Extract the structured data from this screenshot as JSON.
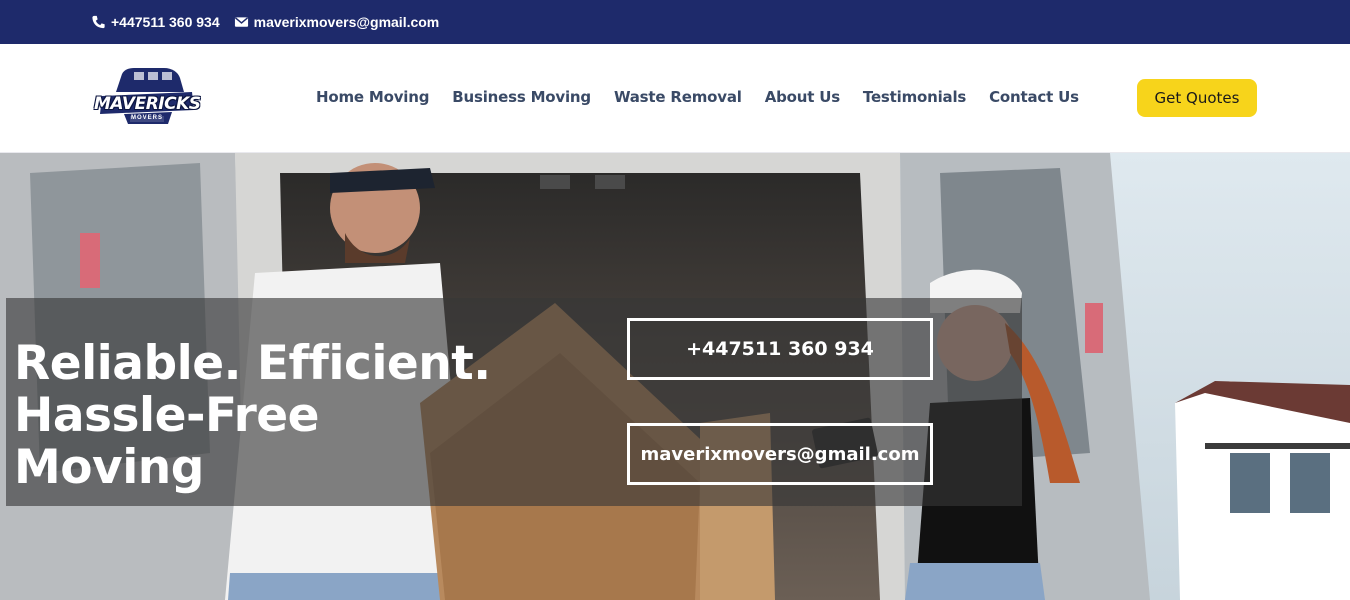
{
  "topbar": {
    "phone": "+447511 360 934",
    "email": "maverixmovers@gmail.com",
    "phone_icon": "phone-icon",
    "email_icon": "envelope-icon",
    "background": "#1e2a6b"
  },
  "logo": {
    "name": "MAVERICKS",
    "tagline": "MOVERS"
  },
  "nav": {
    "items": [
      {
        "label": "Home Moving"
      },
      {
        "label": "Business Moving"
      },
      {
        "label": "Waste Removal"
      },
      {
        "label": "About Us"
      },
      {
        "label": "Testimonials"
      },
      {
        "label": "Contact Us"
      }
    ],
    "cta_label": "Get Quotes",
    "cta_color": "#f7d41b"
  },
  "hero": {
    "headline_line1": "Reliable. Efficient.",
    "headline_line2": "Hassle-Free Moving",
    "phone_button": "+447511 360 934",
    "email_button": "maverixmovers@gmail.com",
    "image": "movers-unloading-van-photo"
  }
}
